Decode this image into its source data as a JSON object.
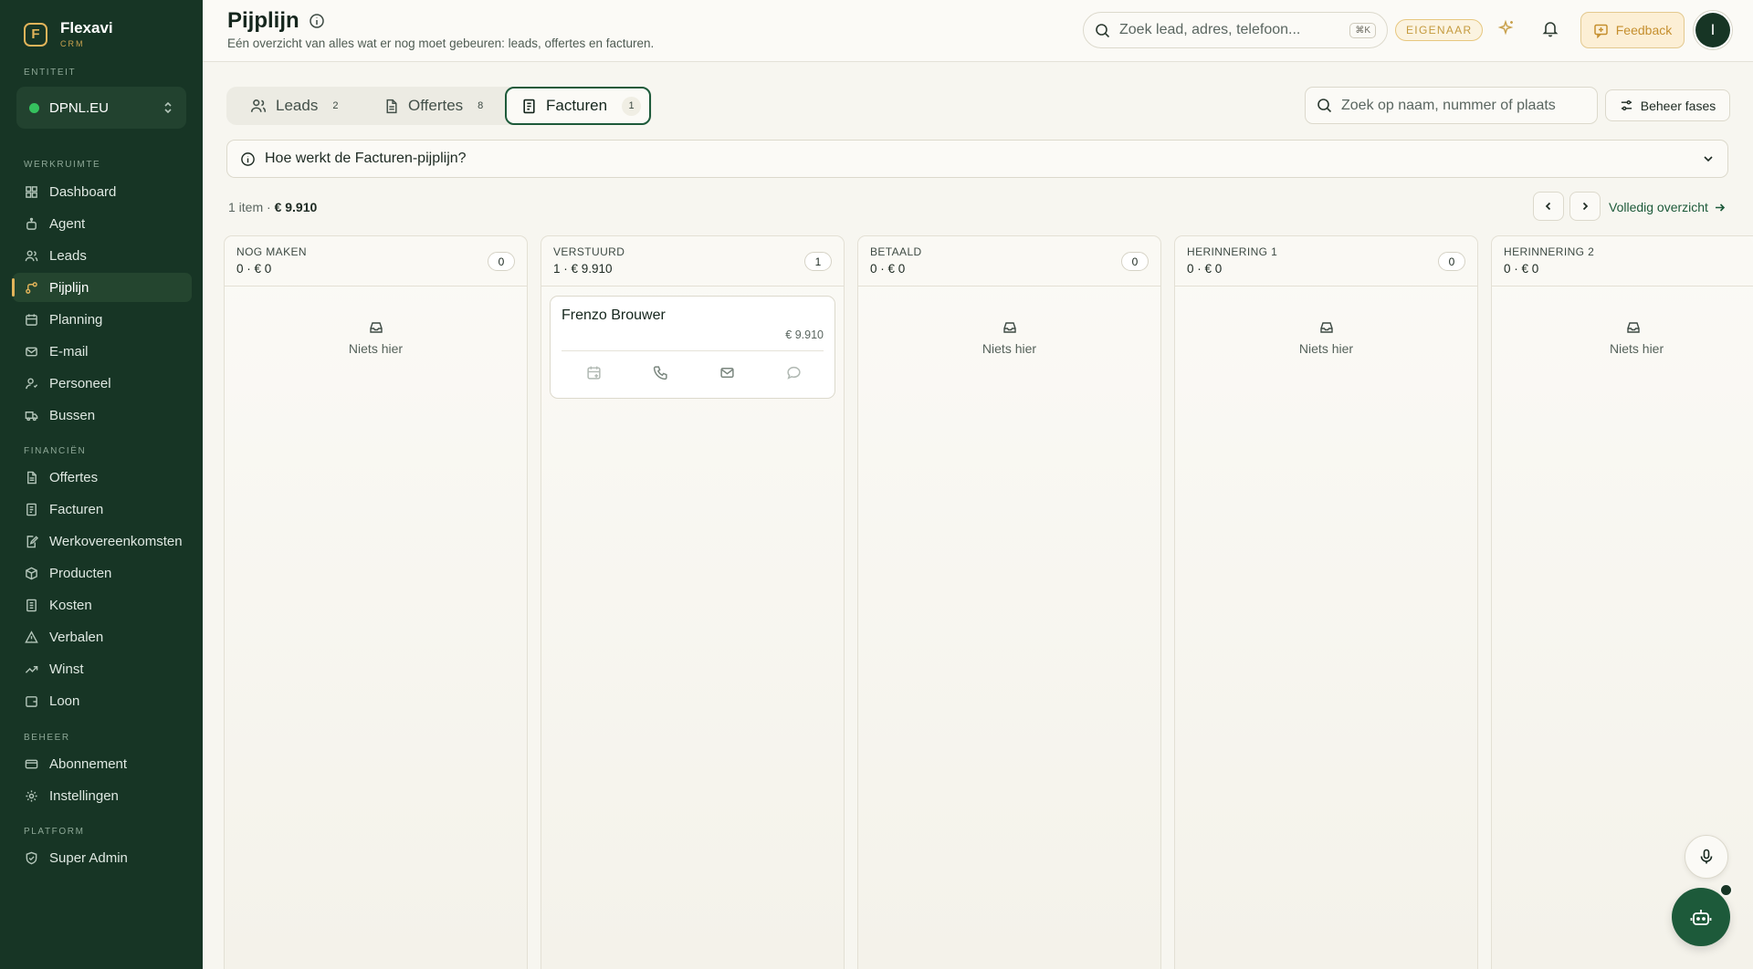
{
  "app": {
    "name": "Flexavi",
    "sub": "CRM",
    "logo_letter": "F"
  },
  "sidebar": {
    "entity_label": "ENTITEIT",
    "entity_name": "DPNL.EU",
    "sections": {
      "werkruimte": "WERKRUIMTE",
      "financien": "FINANCIËN",
      "beheer": "BEHEER",
      "platform": "PLATFORM"
    },
    "items": [
      {
        "label": "Dashboard",
        "icon": "dashboard-icon"
      },
      {
        "label": "Agent",
        "icon": "robot-icon"
      },
      {
        "label": "Leads",
        "icon": "users-icon"
      },
      {
        "label": "Pijplijn",
        "icon": "pipeline-icon",
        "active": true
      },
      {
        "label": "Planning",
        "icon": "calendar-icon"
      },
      {
        "label": "E-mail",
        "icon": "mail-icon"
      },
      {
        "label": "Personeel",
        "icon": "staff-icon"
      },
      {
        "label": "Bussen",
        "icon": "truck-icon"
      },
      {
        "label": "Offertes",
        "icon": "document-icon"
      },
      {
        "label": "Facturen",
        "icon": "invoice-icon"
      },
      {
        "label": "Werkovereenkomsten",
        "icon": "agreement-icon"
      },
      {
        "label": "Producten",
        "icon": "package-icon"
      },
      {
        "label": "Kosten",
        "icon": "receipt-icon"
      },
      {
        "label": "Verbalen",
        "icon": "warning-icon"
      },
      {
        "label": "Winst",
        "icon": "trending-up-icon"
      },
      {
        "label": "Loon",
        "icon": "wallet-icon"
      },
      {
        "label": "Abonnement",
        "icon": "credit-card-icon"
      },
      {
        "label": "Instellingen",
        "icon": "settings-icon"
      },
      {
        "label": "Super Admin",
        "icon": "shield-icon"
      }
    ]
  },
  "header": {
    "title": "Pijplijn",
    "subtitle": "Eén overzicht van alles wat er nog moet gebeuren: leads, offertes en facturen.",
    "search_placeholder": "Zoek lead, adres, telefoon...",
    "search_shortcut": "⌘K",
    "role_badge": "EIGENAAR",
    "feedback_label": "Feedback",
    "avatar_initial": "I"
  },
  "tabs": [
    {
      "label": "Leads",
      "count": "2",
      "icon": "users-icon"
    },
    {
      "label": "Offertes",
      "count": "8",
      "icon": "document-icon"
    },
    {
      "label": "Facturen",
      "count": "1",
      "icon": "invoice-icon",
      "active": true
    }
  ],
  "board": {
    "search_placeholder": "Zoek op naam, nummer of plaats",
    "manage_phases_label": "Beheer fases",
    "help_text": "Hoe werkt de Facturen-pijplijn?",
    "summary_count": "1 item · ",
    "summary_total": "€ 9.910",
    "overview_link": "Volledig overzicht",
    "empty_text": "Niets hier",
    "columns": [
      {
        "title": "NOG MAKEN",
        "stats": "0 · € 0",
        "count": "0"
      },
      {
        "title": "VERSTUURD",
        "stats": "1 · € 9.910",
        "count": "1"
      },
      {
        "title": "BETAALD",
        "stats": "0 · € 0",
        "count": "0"
      },
      {
        "title": "HERINNERING 1",
        "stats": "0 · € 0",
        "count": "0"
      },
      {
        "title": "HERINNERING 2",
        "stats": "0 · € 0",
        "count": "0"
      }
    ],
    "card": {
      "name": "Frenzo Brouwer",
      "amount": "€ 9.910"
    }
  }
}
